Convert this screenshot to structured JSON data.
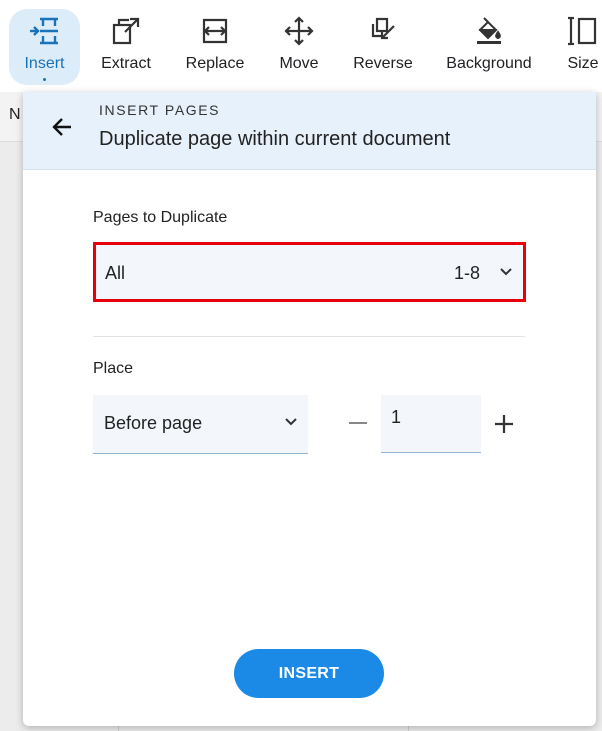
{
  "toolbar": {
    "items": [
      {
        "label": "Insert",
        "icon": "insert-icon",
        "active": true
      },
      {
        "label": "Extract",
        "icon": "extract-icon"
      },
      {
        "label": "Replace",
        "icon": "replace-icon"
      },
      {
        "label": "Move",
        "icon": "move-icon"
      },
      {
        "label": "Reverse",
        "icon": "reverse-icon"
      },
      {
        "label": "Background",
        "icon": "background-icon"
      },
      {
        "label": "Size",
        "icon": "size-icon"
      }
    ],
    "accent_color": "#1a73b8",
    "active_bg": "#dcecf9"
  },
  "background": {
    "partial_text": "N"
  },
  "dialog": {
    "overline": "INSERT PAGES",
    "title": "Duplicate page within current document",
    "back_icon": "arrow-left-icon",
    "pages_label": "Pages to Duplicate",
    "pages_select": {
      "value": "All",
      "range": "1-8"
    },
    "place_label": "Place",
    "place_select": {
      "value": "Before page"
    },
    "page_number": "1",
    "insert_label": "INSERT",
    "highlight_color": "#e8000b",
    "button_color": "#1a8ae6"
  }
}
